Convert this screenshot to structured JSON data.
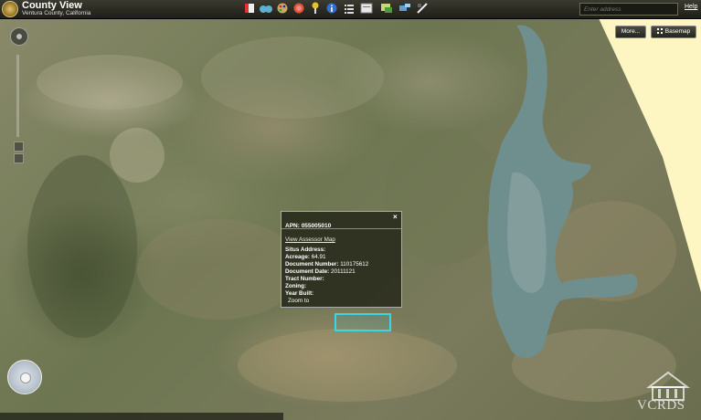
{
  "app": {
    "title": "County View",
    "subtitle": "Ventura County, California"
  },
  "toolbar": {
    "icons": [
      "layers-icon",
      "binoculars-icon",
      "palette-icon",
      "record-icon",
      "pushpin-icon",
      "info-icon",
      "list-icon",
      "print-icon",
      "identify-icon",
      "tools-icon"
    ]
  },
  "search": {
    "placeholder": "Enter address"
  },
  "help_label": "Help",
  "buttons": {
    "more_label": "More...",
    "basemap_label": "Basemap"
  },
  "popup": {
    "title": "APN: 055005010",
    "link": "View Assessor Map",
    "rows": [
      {
        "label": "Situs Address:",
        "value": ""
      },
      {
        "label": "Acreage:",
        "value": "64.91"
      },
      {
        "label": "Document Number:",
        "value": "110175612"
      },
      {
        "label": "Document Date:",
        "value": "20111121"
      },
      {
        "label": "Tract Number:",
        "value": ""
      },
      {
        "label": "Zoning:",
        "value": ""
      },
      {
        "label": "Year Built:",
        "value": ""
      }
    ],
    "close_symbol": "×",
    "zoom_label": "Zoom to"
  },
  "watermark": "VCRDS",
  "colors": {
    "parcel_outline": "#38d6e6",
    "popup_bg": "#26281a",
    "lake": "#6f8f8f",
    "boundary_yellow": "#fdf6c3"
  }
}
